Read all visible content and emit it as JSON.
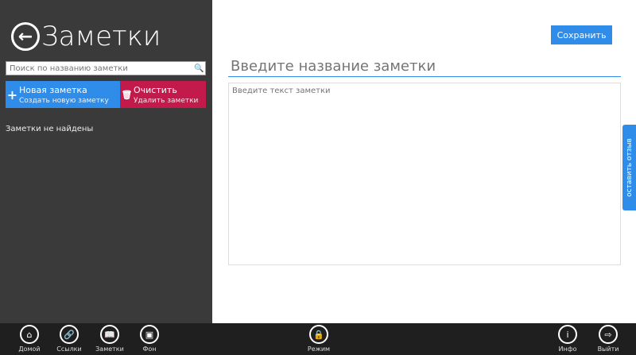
{
  "sidebar": {
    "title": "Заметки",
    "search_placeholder": "Поиск по названию заметки",
    "new_note": {
      "label": "Новая заметка",
      "sub": "Создать новую заметку"
    },
    "clear": {
      "label": "Очистить",
      "sub": "Удалить заметки"
    },
    "empty": "Заметки не найдены"
  },
  "editor": {
    "save": "Сохранить",
    "title_placeholder": "Введите название заметки",
    "text_placeholder": "Введите текст заметки"
  },
  "feedback": "оставить отзыв",
  "nav": [
    {
      "label": "Домой"
    },
    {
      "label": "Ссылки"
    },
    {
      "label": "Заметки"
    },
    {
      "label": "Фон"
    },
    {
      "label": "Режим"
    },
    {
      "label": "Инфо"
    },
    {
      "label": "Выйти"
    }
  ]
}
